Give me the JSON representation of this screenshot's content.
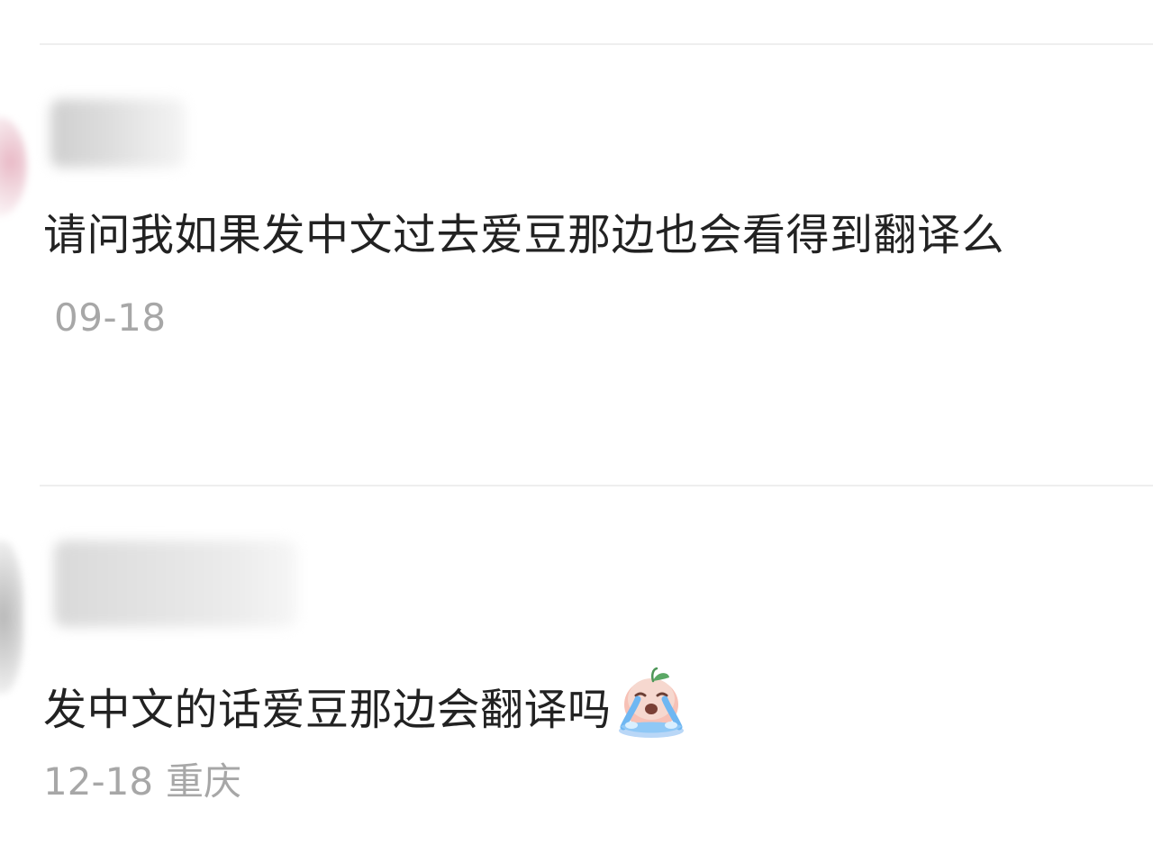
{
  "comments": [
    {
      "text": "请问我如果发中文过去爱豆那边也会看得到翻译么",
      "date": "09-18"
    },
    {
      "text": "发中文的话爱豆那边会翻译吗",
      "emoji": "crying-emoji",
      "date": "12-18",
      "location": "重庆"
    }
  ]
}
